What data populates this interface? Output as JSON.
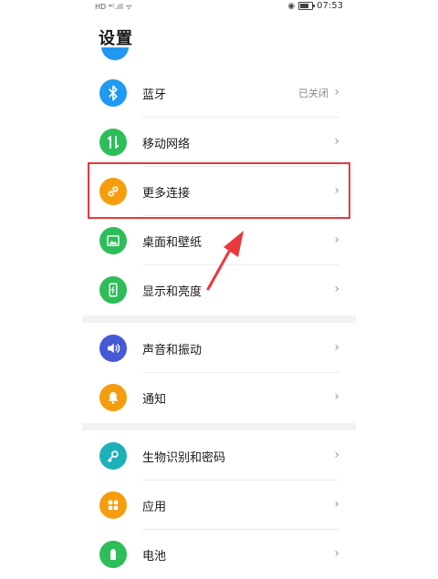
{
  "status_bar": {
    "left_text": "HD ⁴ᴳ.ıll ᯤ",
    "time": "07:53"
  },
  "page": {
    "title": "设置"
  },
  "settings": {
    "rows": [
      {
        "label": "蓝牙",
        "value": "已关闭",
        "icon": "bluetooth-icon",
        "color": "#1e9bf0"
      },
      {
        "label": "移动网络",
        "value": "",
        "icon": "mobile-network-icon",
        "color": "#2ebd59"
      },
      {
        "label": "更多连接",
        "value": "",
        "icon": "link-icon",
        "color": "#f59d0e"
      },
      {
        "label": "桌面和壁纸",
        "value": "",
        "icon": "wallpaper-icon",
        "color": "#2ebd59"
      },
      {
        "label": "显示和亮度",
        "value": "",
        "icon": "display-icon",
        "color": "#2ebd59"
      },
      {
        "label": "声音和振动",
        "value": "",
        "icon": "sound-icon",
        "color": "#4558d6"
      },
      {
        "label": "通知",
        "value": "",
        "icon": "notification-icon",
        "color": "#f59d0e"
      },
      {
        "label": "生物识别和密码",
        "value": "",
        "icon": "key-icon",
        "color": "#1eb0b8"
      },
      {
        "label": "应用",
        "value": "",
        "icon": "apps-icon",
        "color": "#f59d0e"
      },
      {
        "label": "电池",
        "value": "",
        "icon": "battery-icon",
        "color": "#2ebd59"
      }
    ],
    "chevron": "›"
  },
  "annotation": {
    "highlight_color": "#e8393f"
  }
}
